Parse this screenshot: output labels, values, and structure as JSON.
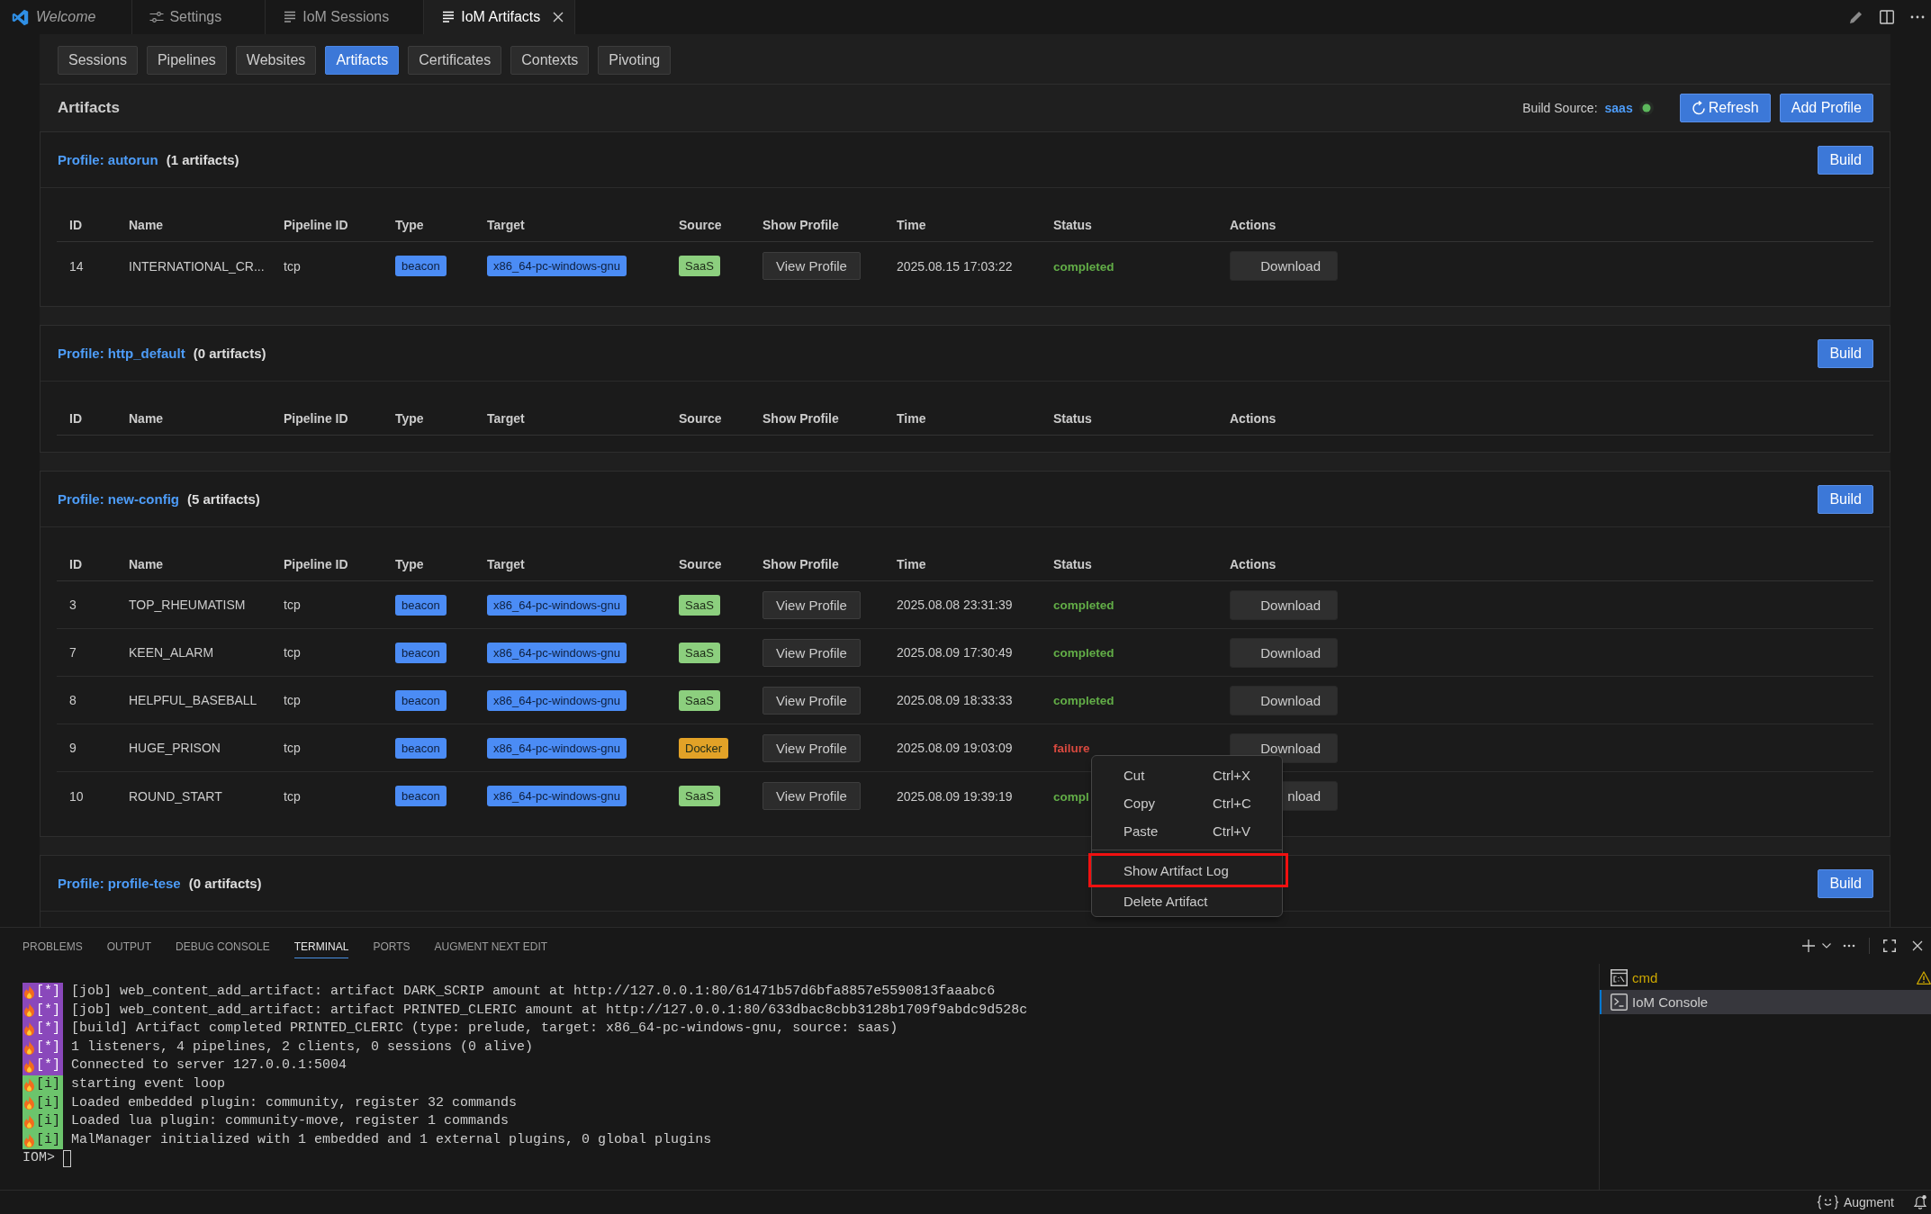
{
  "editor_tabs": [
    {
      "label": "Welcome",
      "kind": "welcome",
      "preview": true,
      "selected": false
    },
    {
      "label": "Settings",
      "kind": "settings",
      "preview": false,
      "selected": false
    },
    {
      "label": "IoM Sessions",
      "kind": "document",
      "preview": false,
      "selected": false
    },
    {
      "label": "IoM Artifacts",
      "kind": "document",
      "preview": false,
      "selected": true
    }
  ],
  "nav_tabs": [
    {
      "label": "Sessions",
      "selected": false
    },
    {
      "label": "Pipelines",
      "selected": false
    },
    {
      "label": "Websites",
      "selected": false
    },
    {
      "label": "Artifacts",
      "selected": true
    },
    {
      "label": "Certificates",
      "selected": false
    },
    {
      "label": "Contexts",
      "selected": false
    },
    {
      "label": "Pivoting",
      "selected": false
    }
  ],
  "header": {
    "title": "Artifacts",
    "build_source_label": "Build Source:",
    "build_source": "saas",
    "source_online": true,
    "refresh_button": "Refresh",
    "add_profile_button": "Add Profile"
  },
  "profiles": [
    {
      "title": "Profile: autorun",
      "count": "(1 artifacts)",
      "build_button": "Build",
      "columns": [
        "ID",
        "Name",
        "Pipeline ID",
        "Type",
        "Target",
        "Source",
        "Show Profile",
        "Time",
        "Status",
        "Actions"
      ],
      "rows": [
        {
          "id": "14",
          "name": "INTERNATIONAL_CR...",
          "pipeline_id": "tcp",
          "type": "beacon",
          "target": "x86_64-pc-windows-gnu",
          "source": {
            "label": "SaaS",
            "color": "#8ccf7e"
          },
          "show_profile": "View Profile",
          "time": "2025.08.15 17:03:22",
          "status": {
            "label": "completed",
            "color": "#62ad47"
          },
          "action": "Download"
        }
      ]
    },
    {
      "title": "Profile: http_default",
      "count": "(0 artifacts)",
      "build_button": "Build",
      "columns": [
        "ID",
        "Name",
        "Pipeline ID",
        "Type",
        "Target",
        "Source",
        "Show Profile",
        "Time",
        "Status",
        "Actions"
      ]
    },
    {
      "title": "Profile: new-config",
      "count": "(5 artifacts)",
      "build_button": "Build",
      "columns": [
        "ID",
        "Name",
        "Pipeline ID",
        "Type",
        "Target",
        "Source",
        "Show Profile",
        "Time",
        "Status",
        "Actions"
      ],
      "rows": [
        {
          "id": "3",
          "name": "TOP_RHEUMATISM",
          "pipeline_id": "tcp",
          "type": "beacon",
          "target": "x86_64-pc-windows-gnu",
          "source": {
            "label": "SaaS",
            "color": "#8ccf7e"
          },
          "show_profile": "View Profile",
          "time": "2025.08.08 23:31:39",
          "status": {
            "label": "completed",
            "color": "#62ad47"
          },
          "action": "Download"
        },
        {
          "id": "7",
          "name": "KEEN_ALARM",
          "pipeline_id": "tcp",
          "type": "beacon",
          "target": "x86_64-pc-windows-gnu",
          "source": {
            "label": "SaaS",
            "color": "#8ccf7e"
          },
          "show_profile": "View Profile",
          "time": "2025.08.09 17:30:49",
          "status": {
            "label": "completed",
            "color": "#62ad47"
          },
          "action": "Download"
        },
        {
          "id": "8",
          "name": "HELPFUL_BASEBALL",
          "pipeline_id": "tcp",
          "type": "beacon",
          "target": "x86_64-pc-windows-gnu",
          "source": {
            "label": "SaaS",
            "color": "#8ccf7e"
          },
          "show_profile": "View Profile",
          "time": "2025.08.09 18:33:33",
          "status": {
            "label": "completed",
            "color": "#62ad47"
          },
          "action": "Download"
        },
        {
          "id": "9",
          "name": "HUGE_PRISON",
          "pipeline_id": "tcp",
          "type": "beacon",
          "target": "x86_64-pc-windows-gnu",
          "source": {
            "label": "Docker",
            "color": "#e2a227"
          },
          "show_profile": "View Profile",
          "time": "2025.08.09 19:03:09",
          "status": {
            "label": "failure",
            "color": "#d8493f"
          },
          "action": "Download"
        },
        {
          "id": "10",
          "name": "ROUND_START",
          "pipeline_id": "tcp",
          "type": "beacon",
          "target": "x86_64-pc-windows-gnu",
          "source": {
            "label": "SaaS",
            "color": "#8ccf7e"
          },
          "show_profile": "View Profile",
          "time": "2025.08.09 19:39:19",
          "status": {
            "label": "compl",
            "color": "#62ad47"
          },
          "action": "nload"
        }
      ]
    },
    {
      "title": "Profile: profile-tese",
      "count": "(0 artifacts)",
      "build_button": "Build"
    }
  ],
  "context_menu": {
    "groups": [
      {
        "items": [
          {
            "label": "Cut",
            "shortcut": "Ctrl+X",
            "highlighted": false
          },
          {
            "label": "Copy",
            "shortcut": "Ctrl+C",
            "highlighted": false
          },
          {
            "label": "Paste",
            "shortcut": "Ctrl+V",
            "highlighted": false
          }
        ]
      },
      {
        "items": [
          {
            "label": "Show Artifact Log",
            "highlighted": true
          },
          {
            "label": "Delete Artifact",
            "highlighted": false
          }
        ]
      }
    ]
  },
  "panel": {
    "tabs": [
      {
        "label": "PROBLEMS",
        "selected": false
      },
      {
        "label": "OUTPUT",
        "selected": false
      },
      {
        "label": "DEBUG CONSOLE",
        "selected": false
      },
      {
        "label": "TERMINAL",
        "selected": true
      },
      {
        "label": "PORTS",
        "selected": false
      },
      {
        "label": "AUGMENT NEXT EDIT",
        "selected": false
      }
    ],
    "terminal": {
      "lines": [
        {
          "kind": "star",
          "badge": "[*]",
          "text": "[job] web_content_add_artifact: artifact DARK_SCRIP amount at http://127.0.0.1:80/61471b57d6bfa8857e5590813faaabc6"
        },
        {
          "kind": "star",
          "badge": "[*]",
          "text": "[job] web_content_add_artifact: artifact PRINTED_CLERIC amount at http://127.0.0.1:80/633dbac8cbb3128b1709f9abdc9d528c"
        },
        {
          "kind": "star",
          "badge": "[*]",
          "text": "[build] Artifact completed PRINTED_CLERIC (type: prelude, target: x86_64-pc-windows-gnu, source: saas)"
        },
        {
          "kind": "star",
          "badge": "[*]",
          "text": "1 listeners, 4 pipelines, 2 clients, 0 sessions (0 alive)"
        },
        {
          "kind": "star",
          "badge": "[*]",
          "text": "Connected to server 127.0.0.1:5004"
        },
        {
          "kind": "info",
          "badge": "[i]",
          "text": "starting event loop"
        },
        {
          "kind": "info",
          "badge": "[i]",
          "text": "Loaded embedded plugin: community, register 32 commands"
        },
        {
          "kind": "info",
          "badge": "[i]",
          "text": "Loaded lua plugin: community-move, register 1 commands"
        },
        {
          "kind": "info",
          "badge": "[i]",
          "text": "MalManager initialized with 1 embedded and 1 external plugins, 0 global plugins"
        }
      ],
      "prompt": "IOM>"
    },
    "terminals": [
      {
        "label": "cmd",
        "kind": "cmd",
        "warning": true,
        "selected": false
      },
      {
        "label": "IoM Console",
        "kind": "console",
        "warning": false,
        "selected": true
      }
    ]
  },
  "status_bar": {
    "augment": "Augment"
  }
}
